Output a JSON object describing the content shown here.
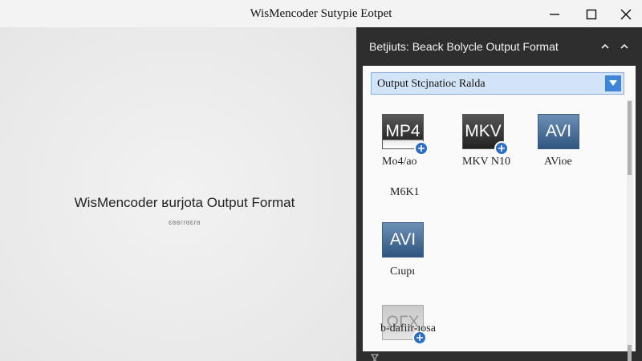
{
  "window": {
    "title": "WisMencoder Sutypie Eotpet"
  },
  "left_pane": {
    "title": "WisMencoder ʁurjota Output Format",
    "subtitle": "ɛɞɞɾɾɞɛɾɞ"
  },
  "panel": {
    "title": "Betjiuts: Beack Bolycle Output Format",
    "dropdown": {
      "selected": "Output Stcjnatioc Ralda"
    },
    "formats": [
      {
        "badge": "MP4",
        "label": "Mo4/ao",
        "style": "dark",
        "icon": "plus-circle-icon"
      },
      {
        "badge": "MKV",
        "label": "MKV N10",
        "style": "dark",
        "icon": "plus-circle-icon"
      },
      {
        "badge": "AVI",
        "label": "AVioe",
        "style": "blue"
      },
      {
        "badge": "",
        "label": "M6K1",
        "style": "none"
      },
      {
        "badge": "AVI",
        "label": "Cıupı",
        "style": "blue"
      },
      {
        "badge": "ΩΓΧ",
        "label": "b-dafiir-ıosa",
        "style": "faded",
        "icon": "plus-circle-icon"
      }
    ]
  },
  "colors": {
    "panel_bg": "#2e2e2e",
    "dropdown_bg": "#d3e4f8",
    "accent_blue": "#3f86d6",
    "badge_blue": "#3a5d84"
  }
}
